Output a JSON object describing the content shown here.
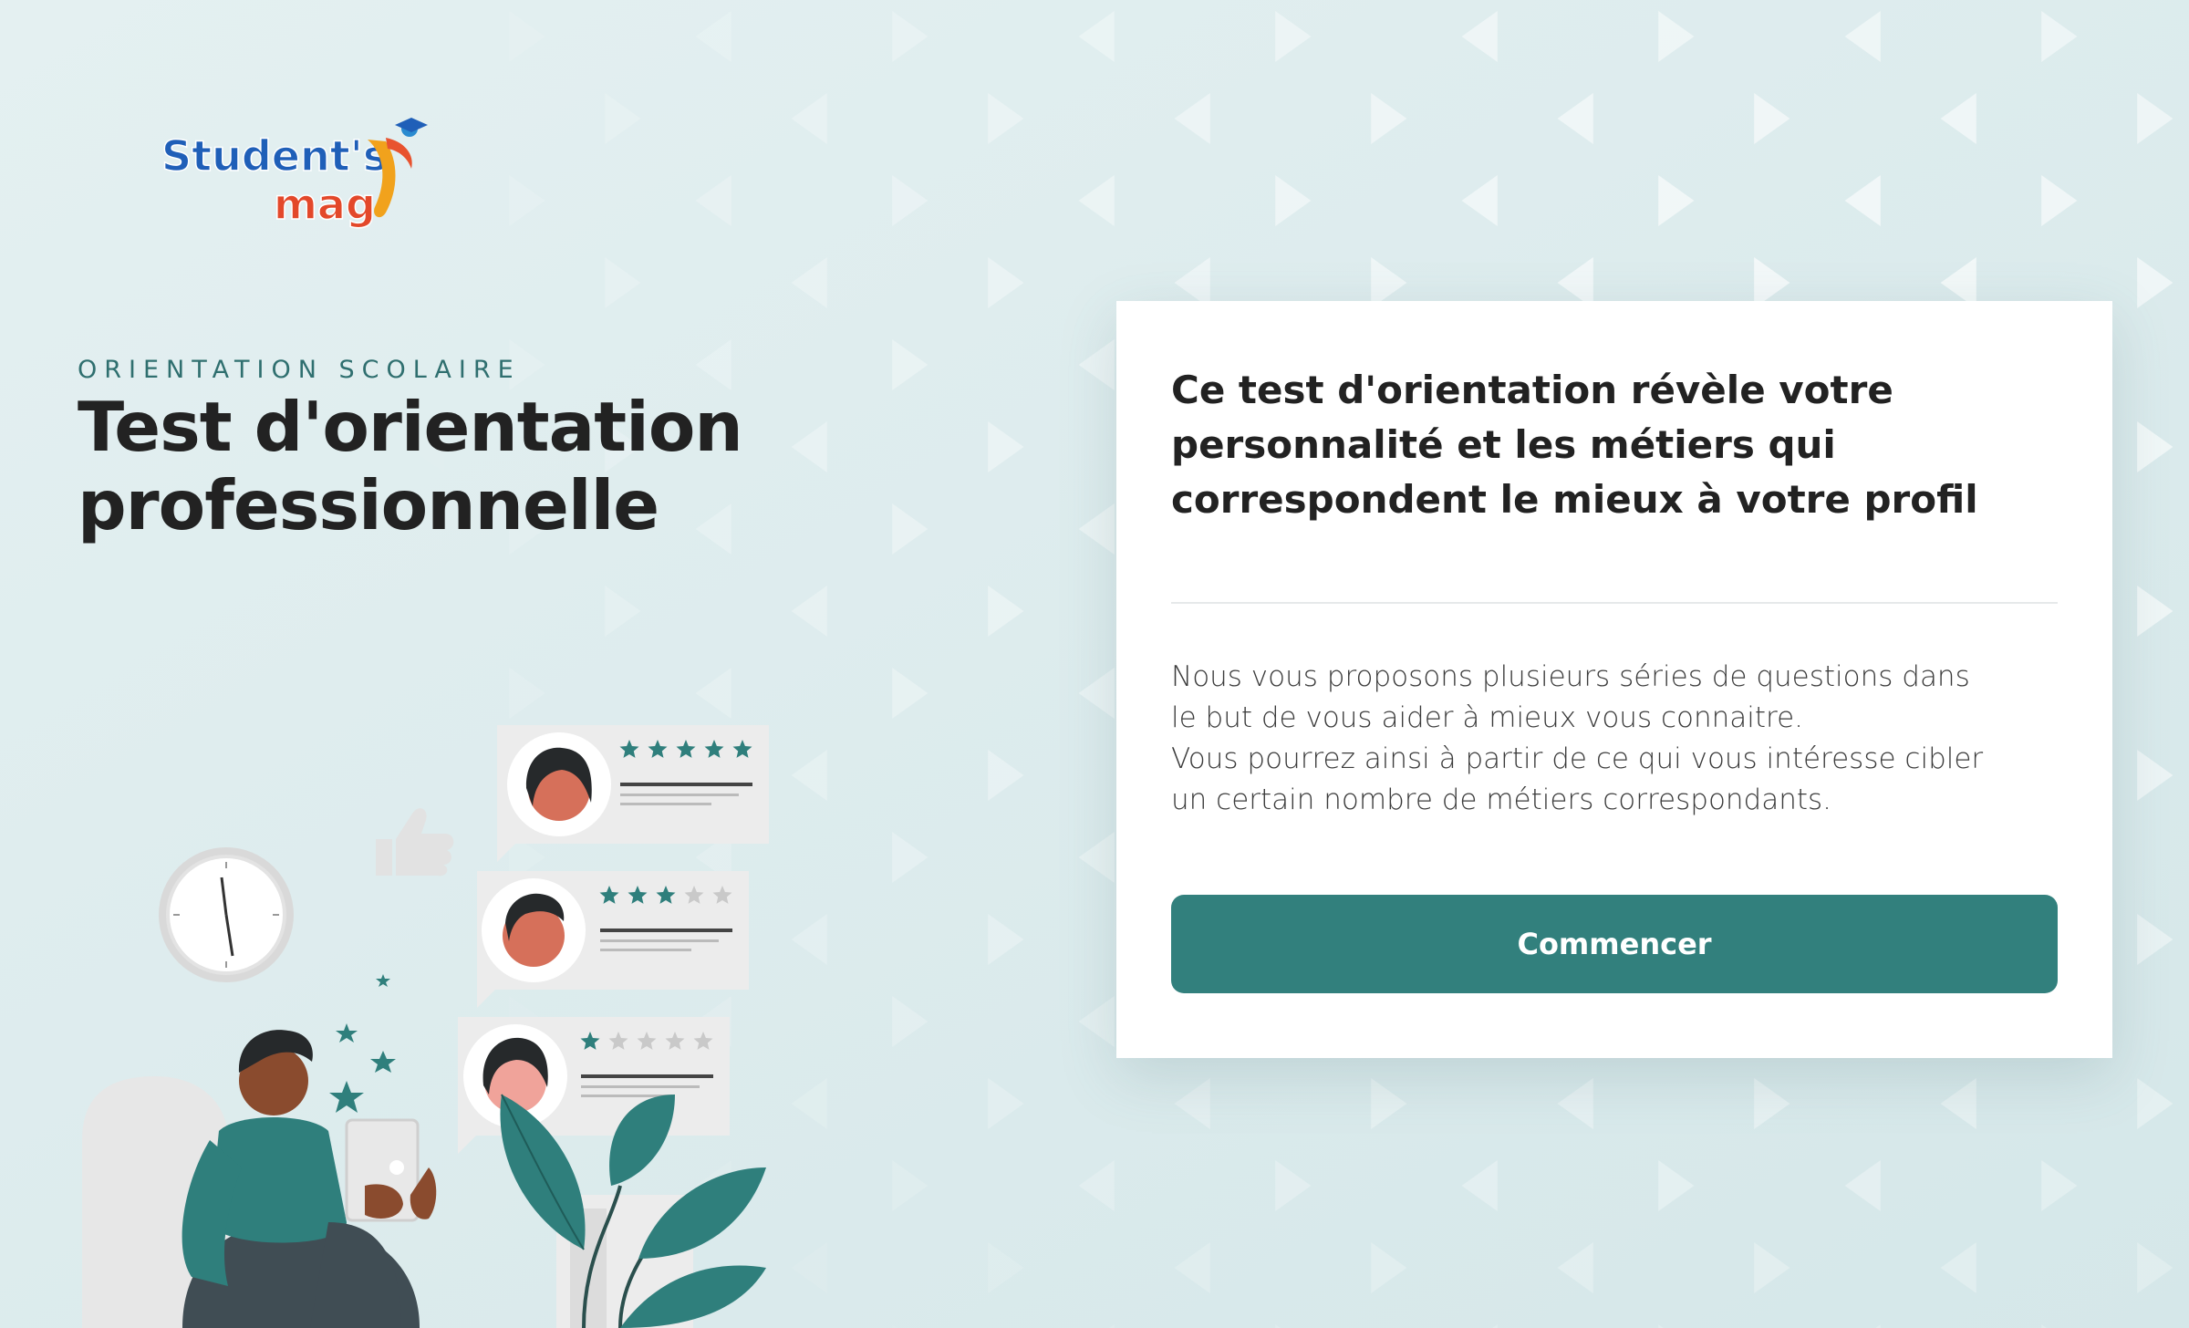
{
  "brand": {
    "logo_word_1": "Student's",
    "logo_word_2": "mag"
  },
  "hero": {
    "eyebrow": "ORIENTATION SCOLAIRE",
    "title_line_1": "Test d'orientation",
    "title_line_2": "professionnelle"
  },
  "card": {
    "heading_line_1": "Ce test d'orientation révèle votre",
    "heading_line_2": "personnalité et les métiers qui",
    "heading_line_3": "correspondent le mieux à votre profil",
    "body_line_1": "Nous vous proposons plusieurs séries de questions dans",
    "body_line_2": "le but de vous aider à mieux vous connaitre.",
    "body_line_3": "Vous pourrez ainsi à partir de ce qui vous intéresse cibler",
    "body_line_4": "un certain nombre de métiers correspondants.",
    "button_label": "Commencer"
  },
  "ratings": [
    5,
    3,
    1
  ],
  "colors": {
    "accent": "#32807d",
    "background": "#dcebed",
    "card": "#ffffff",
    "text": "#222222"
  },
  "icons": [
    "clock-icon",
    "thumbs-up-icon",
    "thumbs-down-icon",
    "star-icon",
    "plant-icon"
  ]
}
